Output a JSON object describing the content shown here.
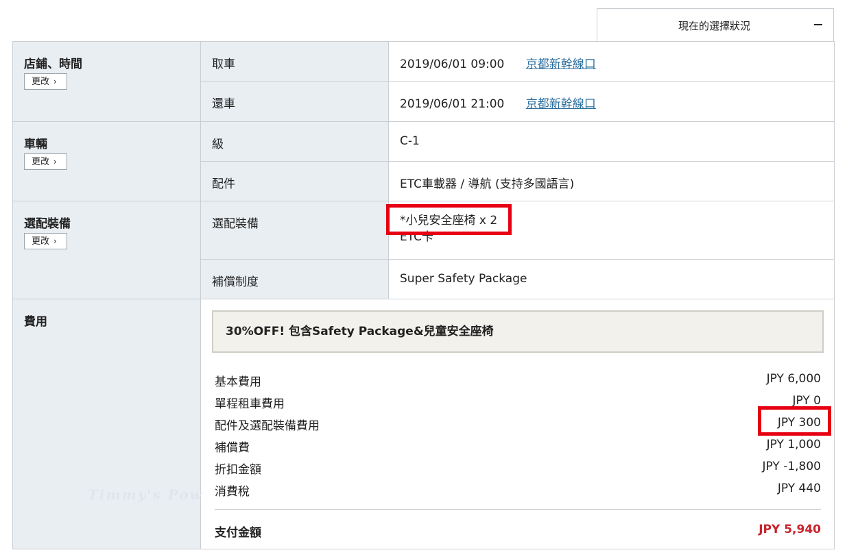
{
  "panel": {
    "title": "現在的選擇狀況"
  },
  "change_label": "更改",
  "sections": {
    "store_time": {
      "label": "店鋪、時間",
      "pickup": {
        "key": "取車",
        "datetime": "2019/06/01 09:00",
        "store": "京都新幹線口"
      },
      "return": {
        "key": "還車",
        "datetime": "2019/06/01 21:00",
        "store": "京都新幹線口"
      }
    },
    "vehicle": {
      "label": "車輛",
      "class": {
        "key": "級",
        "value": "C-1"
      },
      "accessories": {
        "key": "配件",
        "value": "ETC車載器 / 導航 (支持多國語言)"
      }
    },
    "options": {
      "label": "選配裝備",
      "equipment": {
        "key": "選配裝備",
        "line1": "*小兒安全座椅 x 2",
        "line2": "ETC卡"
      },
      "compensation": {
        "key": "補償制度",
        "value": "Super Safety Package"
      }
    },
    "fees": {
      "label": "費用",
      "promo": "30%OFF! 包含Safety Package&兒童安全座椅",
      "lines": [
        {
          "name": "基本費用",
          "amount": "JPY 6,000"
        },
        {
          "name": "單程租車費用",
          "amount": "JPY 0"
        },
        {
          "name": "配件及選配裝備費用",
          "amount": "JPY 300"
        },
        {
          "name": "補償費",
          "amount": "JPY 1,000"
        },
        {
          "name": "折扣金額",
          "amount": "JPY -1,800"
        },
        {
          "name": "消費稅",
          "amount": "JPY 440"
        }
      ],
      "total": {
        "name": "支付金額",
        "amount": "JPY 5,940"
      }
    }
  },
  "watermark": "Timmy's Pow",
  "colors": {
    "label_bg": "#e9eef2",
    "border": "#c9ced3",
    "link": "#2a6e9e",
    "total": "#c8232c",
    "highlight": "#e60012"
  }
}
